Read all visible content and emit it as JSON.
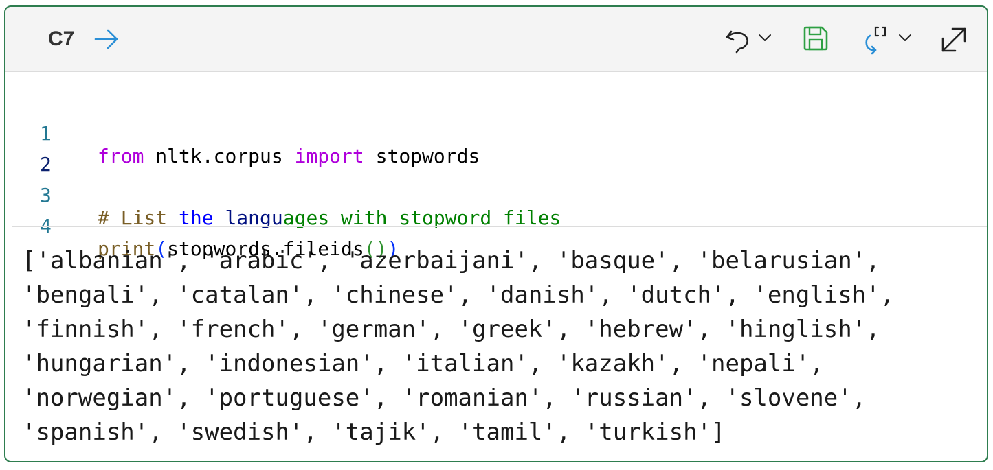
{
  "cell": {
    "id": "C7",
    "colors": {
      "border": "#2e7d4f",
      "save_icon": "#2ea043",
      "run_icon": "#2b8fd6"
    }
  },
  "toolbar": {
    "go_icon": "arrow-right-icon",
    "undo_icon": "undo-icon",
    "save_icon": "save-icon",
    "run_icon": "run-options-icon",
    "expand_icon": "expand-icon"
  },
  "code": {
    "line_numbers": [
      "1",
      "2",
      "3",
      "4"
    ],
    "line1": {
      "kw1": "from",
      "mid": " nltk.corpus ",
      "kw2": "import",
      "rest": " stopwords"
    },
    "line2": "",
    "line3": {
      "hash": "# ",
      "w1": "List",
      "w2": " the ",
      "w3": "langu",
      "w4": "ages with stopword files"
    },
    "line4": {
      "fn": "print",
      "open1": "(",
      "arg": "stopwords.fileids",
      "paren2": "()",
      "close1": ")"
    }
  },
  "output": {
    "lines": [
      "['albanian', 'arabic', 'azerbaijani', 'basque', 'belarusian',",
      "'bengali', 'catalan', 'chinese', 'danish', 'dutch', 'english',",
      "'finnish', 'french', 'german', 'greek', 'hebrew', 'hinglish',",
      "'hungarian', 'indonesian', 'italian', 'kazakh', 'nepali',",
      "'norwegian', 'portuguese', 'romanian', 'russian', 'slovene',",
      "'spanish', 'swedish', 'tajik', 'tamil', 'turkish']"
    ]
  }
}
